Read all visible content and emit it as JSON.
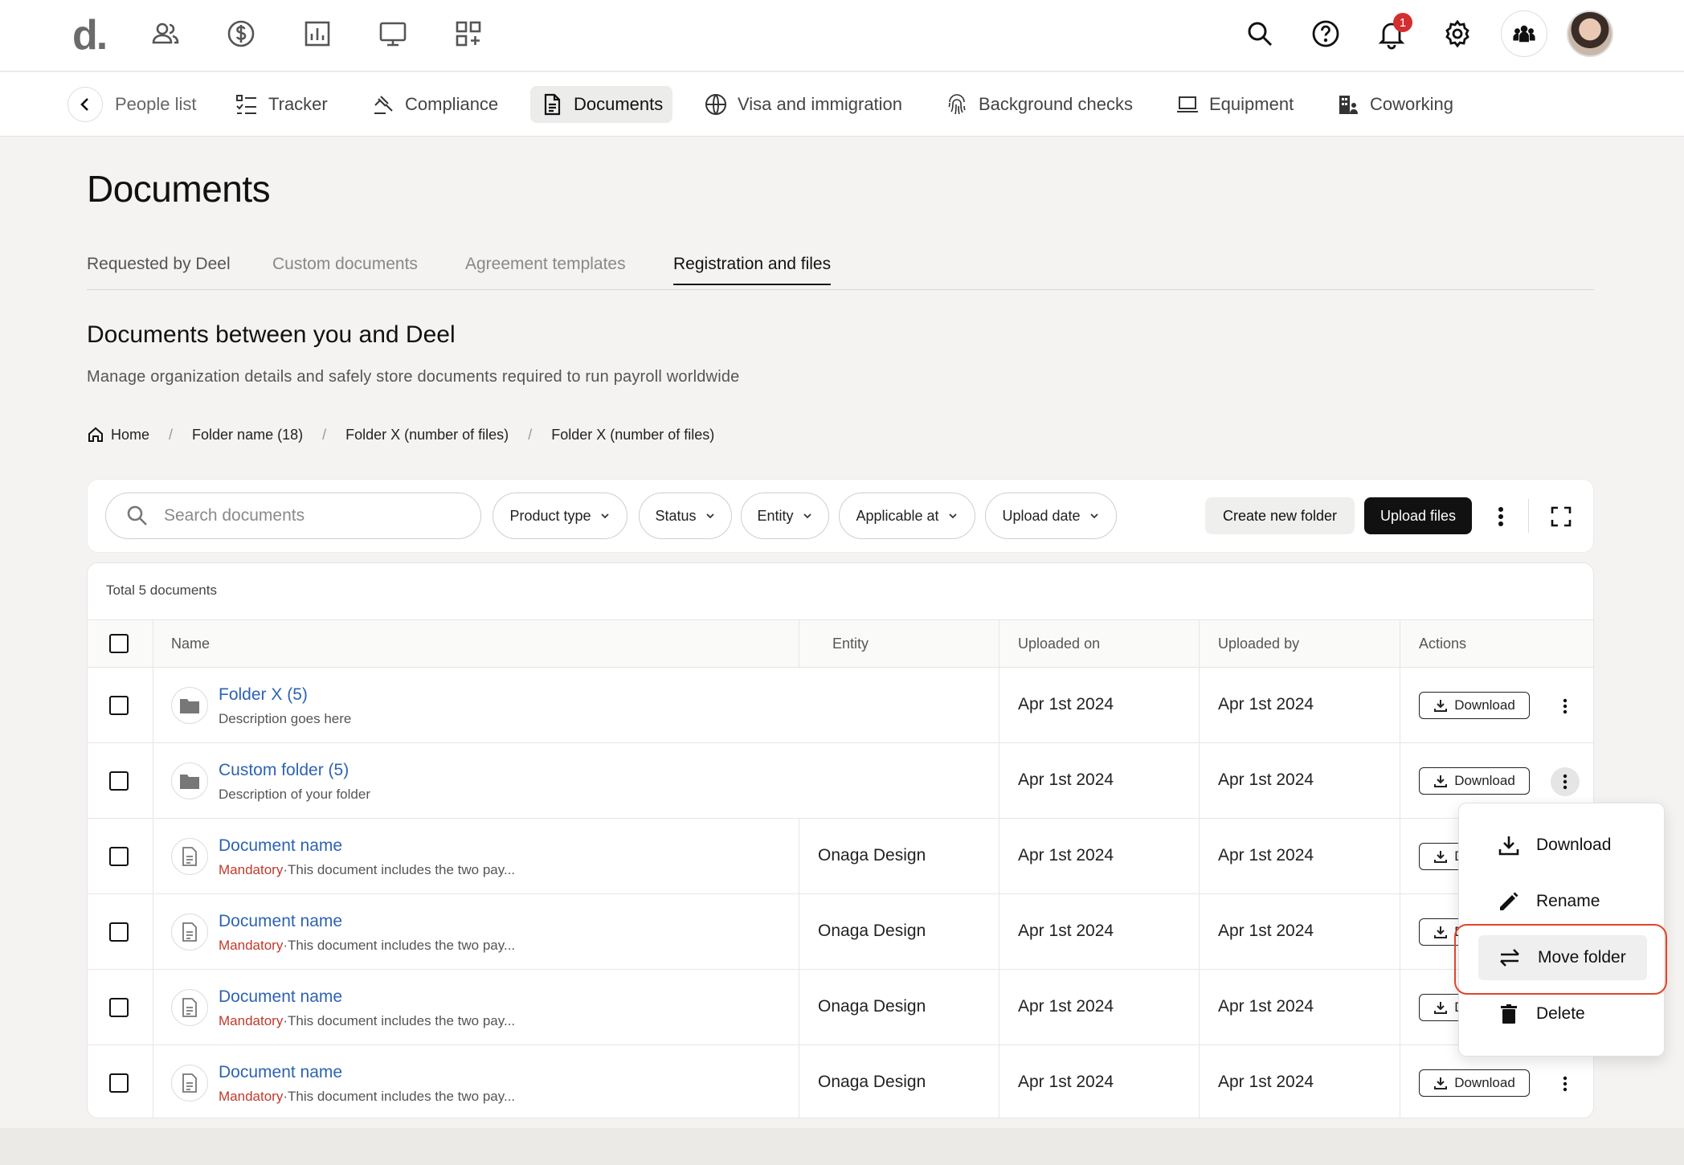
{
  "topbar": {
    "logo": "d.",
    "notification_count": "1",
    "icons": [
      "people-icon",
      "dollar-icon",
      "report-icon",
      "monitor-icon",
      "apps-add-icon",
      "search-icon",
      "help-icon",
      "bell-icon",
      "gear-icon",
      "team-icon"
    ]
  },
  "subnav": {
    "items": [
      {
        "label": "People list"
      },
      {
        "label": "Tracker"
      },
      {
        "label": "Compliance"
      },
      {
        "label": "Documents"
      },
      {
        "label": "Visa and immigration"
      },
      {
        "label": "Background checks"
      },
      {
        "label": "Equipment"
      },
      {
        "label": "Coworking"
      }
    ],
    "active": "Documents"
  },
  "page": {
    "title": "Documents",
    "tabs": [
      "Requested by Deel",
      "Custom documents",
      "Agreement templates",
      "Registration and files"
    ],
    "active_tab": "Registration and files",
    "section_title": "Documents between you and Deel",
    "section_subtitle": "Manage organization details and safely store documents required to run payroll worldwide"
  },
  "breadcrumb": [
    "Home",
    "Folder name (18)",
    "Folder X (number of files)",
    "Folder X (number of files)"
  ],
  "filters": {
    "search_placeholder": "Search documents",
    "chips": [
      "Product type",
      "Status",
      "Entity",
      "Applicable at",
      "Upload date"
    ],
    "create_folder": "Create new folder",
    "upload_files": "Upload files"
  },
  "table": {
    "total": "Total 5 documents",
    "columns": [
      "Name",
      "Entity",
      "Uploaded on",
      "Uploaded by",
      "Actions"
    ],
    "download_label": "Download",
    "rows": [
      {
        "type": "folder",
        "name": "Folder X (5)",
        "desc": "Description goes here",
        "mandatory": "",
        "entity": "",
        "uploaded_on": "Apr 1st 2024",
        "uploaded_by": "Apr 1st 2024"
      },
      {
        "type": "folder",
        "name": "Custom folder (5)",
        "desc": "Description of your folder",
        "mandatory": "",
        "entity": "",
        "uploaded_on": "Apr 1st 2024",
        "uploaded_by": "Apr 1st 2024"
      },
      {
        "type": "doc",
        "name": "Document name",
        "mandatory": "Mandatory",
        "desc": "·This document includes the two pay...",
        "entity": "Onaga Design",
        "uploaded_on": "Apr 1st 2024",
        "uploaded_by": "Apr 1st 2024"
      },
      {
        "type": "doc",
        "name": "Document name",
        "mandatory": "Mandatory",
        "desc": "·This document includes the two pay...",
        "entity": "Onaga Design",
        "uploaded_on": "Apr 1st 2024",
        "uploaded_by": "Apr 1st 2024"
      },
      {
        "type": "doc",
        "name": "Document name",
        "mandatory": "Mandatory",
        "desc": "·This document includes the two pay...",
        "entity": "Onaga Design",
        "uploaded_on": "Apr 1st 2024",
        "uploaded_by": "Apr 1st 2024"
      },
      {
        "type": "doc",
        "name": "Document name",
        "mandatory": "Mandatory",
        "desc": "·This document includes the two pay...",
        "entity": "Onaga Design",
        "uploaded_on": "Apr 1st 2024",
        "uploaded_by": "Apr 1st 2024"
      }
    ]
  },
  "context_menu": {
    "items": [
      "Download",
      "Rename",
      "Move folder",
      "Delete"
    ],
    "highlighted": "Move folder"
  },
  "colors": {
    "link": "#2d63b3",
    "mandatory": "#c0392b",
    "highlight_outline": "#e0452a",
    "badge": "#d32f2f"
  }
}
